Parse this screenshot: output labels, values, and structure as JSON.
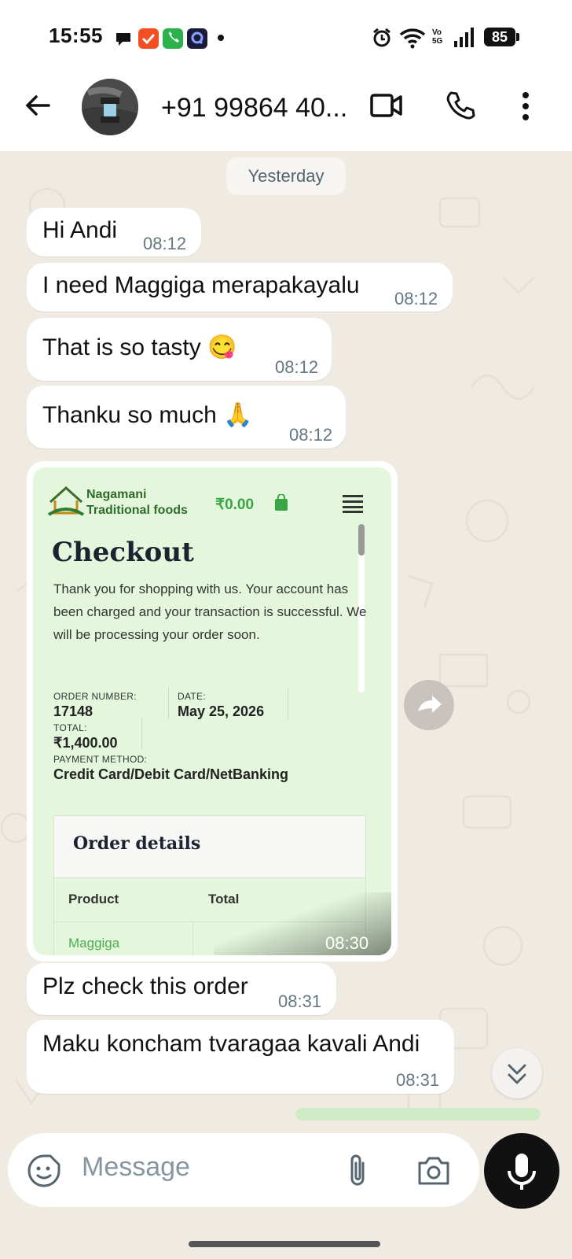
{
  "status_bar": {
    "time": "15:55",
    "battery": "85",
    "network": "Vo 5G"
  },
  "header": {
    "contact_name": "+91 99864 40..."
  },
  "chat": {
    "date_chip": "Yesterday",
    "messages": [
      {
        "text": "Hi Andi",
        "time": "08:12"
      },
      {
        "text": "I need Maggiga merapakayalu",
        "time": "08:12"
      },
      {
        "text": "That is so tasty 😋",
        "time": "08:12"
      },
      {
        "text": "Thanku so much 🙏",
        "time": "08:12"
      },
      {
        "text": "Plz check this order",
        "time": "08:31"
      },
      {
        "text": "Maku koncham tvaragaa kavali Andi",
        "time": "08:31"
      }
    ],
    "image_message": {
      "time": "08:30",
      "shop_name_line1": "Nagamani",
      "shop_name_line2": "Traditional foods",
      "cart_total": "₹0.00",
      "heading": "Checkout",
      "body": "Thank you for shopping with us. Your account has been charged and your transaction is successful. We will be processing your order soon.",
      "order_number_label": "ORDER NUMBER:",
      "order_number": "17148",
      "date_label": "DATE:",
      "date": "May 25, 2026",
      "total_label": "TOTAL:",
      "total": "₹1,400.00",
      "payment_label": "PAYMENT METHOD:",
      "payment": "Credit Card/Debit Card/NetBanking",
      "order_details_heading": "Order details",
      "col_product": "Product",
      "col_total": "Total",
      "first_product": "Maggiga"
    }
  },
  "composer": {
    "placeholder": "Message"
  },
  "colors": {
    "accent": "#25d366",
    "bubble": "#ffffff",
    "chat_bg": "#efeae2",
    "card_bg": "#e4f7dc"
  }
}
